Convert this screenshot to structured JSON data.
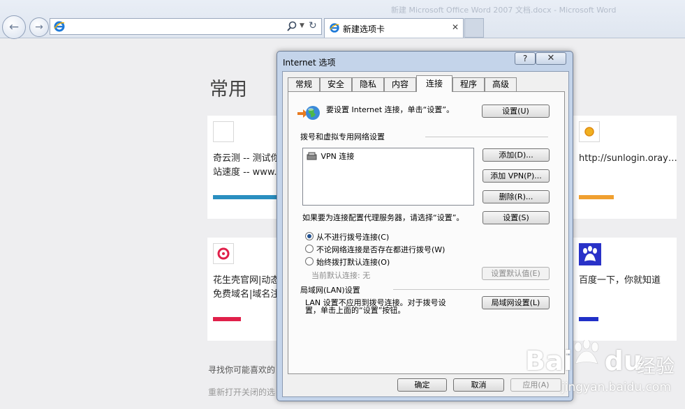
{
  "browser": {
    "titlebar_ghost": "新建 Microsoft Office Word 2007 文档.docx - Microsoft Word",
    "address": {
      "url_ghost": ""
    },
    "tab": {
      "label": "新建选项卡"
    }
  },
  "newtab": {
    "heading": "常用",
    "tiles": [
      {
        "line1": "奇云测 -- 测试你",
        "line2": "站速度 -- www.",
        "bar_color": "#2a8fc0"
      },
      {
        "line1": "http://sunlogin.oray…",
        "line2": "",
        "bar_color": "#f0a030"
      },
      {
        "line1": "花生壳官网|动态",
        "line2": "免费域名|域名注",
        "bar_color": "#e0204a"
      },
      {
        "line1": "百度一下，你就知道",
        "line2": "",
        "bar_color": "#2030c8"
      }
    ],
    "footer_find": "寻找你可能喜欢的",
    "footer_reopen": "重新打开关闭的选"
  },
  "dialog": {
    "title": "Internet 选项",
    "help_label": "?",
    "close_label": "✕",
    "tabs": [
      {
        "label": "常规",
        "active": false
      },
      {
        "label": "安全",
        "active": false
      },
      {
        "label": "隐私",
        "active": false
      },
      {
        "label": "内容",
        "active": false
      },
      {
        "label": "连接",
        "active": true
      },
      {
        "label": "程序",
        "active": false
      },
      {
        "label": "高级",
        "active": false
      }
    ],
    "connections": {
      "setup_text": "要设置 Internet 连接，单击“设置”。",
      "setup_button": "设置(U)",
      "dialup_group_label": "拨号和虚拟专用网络设置",
      "vpn_item": "VPN 连接",
      "add_button": "添加(D)...",
      "add_vpn_button": "添加 VPN(P)...",
      "remove_button": "删除(R)...",
      "proxy_text": "如果要为连接配置代理服务器，请选择“设置”。",
      "settings_button": "设置(S)",
      "radio_options": [
        {
          "label": "从不进行拨号连接(C)",
          "checked": true
        },
        {
          "label": "不论网络连接是否存在都进行拨号(W)",
          "checked": false
        },
        {
          "label": "始终拨打默认连接(O)",
          "checked": false
        }
      ],
      "current_default_label": "当前默认连接:",
      "current_default_value": "无",
      "set_default_button": "设置默认值(E)",
      "lan_group_label": "局域网(LAN)设置",
      "lan_text_line1": "LAN 设置不应用到拨号连接。对于拨号设",
      "lan_text_line2": "置，单击上面的“设置”按钮。",
      "lan_settings_button": "局域网设置(L)"
    },
    "footer": {
      "ok": "确定",
      "cancel": "取消",
      "apply": "应用(A)"
    }
  },
  "watermark": {
    "brand": "Bai",
    "brand2": "du",
    "cn": "经验",
    "url": "jingyan.baidu.com"
  }
}
